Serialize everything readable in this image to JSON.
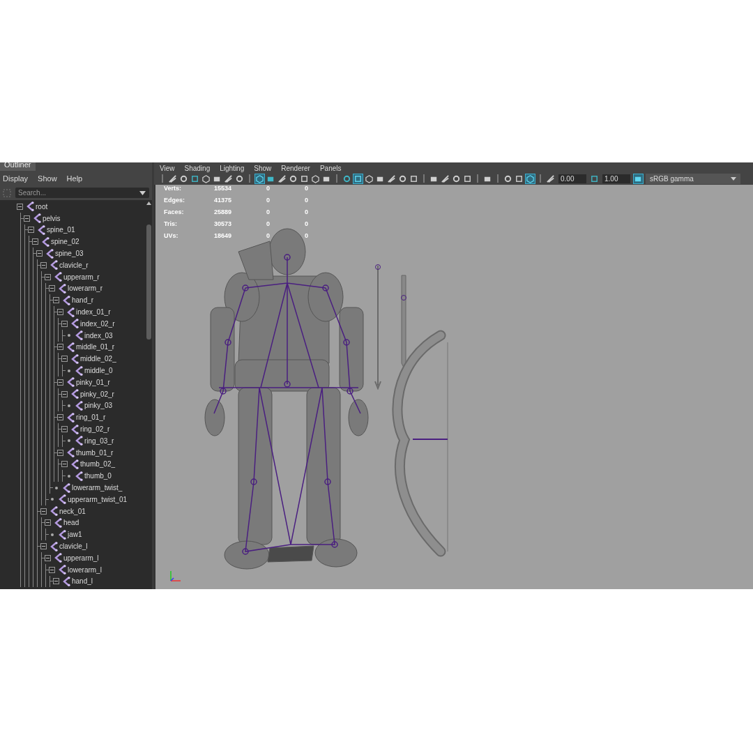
{
  "outliner": {
    "title": "Outliner",
    "menu": [
      "Display",
      "Show",
      "Help"
    ],
    "search": {
      "placeholder": "Search..."
    },
    "tree": [
      {
        "label": "root",
        "expanded": true,
        "children": [
          {
            "label": "pelvis",
            "expanded": true,
            "children": [
              {
                "label": "spine_01",
                "expanded": true,
                "children": [
                  {
                    "label": "spine_02",
                    "expanded": true,
                    "children": [
                      {
                        "label": "spine_03",
                        "expanded": true,
                        "children": [
                          {
                            "label": "clavicle_r",
                            "expanded": true,
                            "children": [
                              {
                                "label": "upperarm_r",
                                "expanded": true,
                                "children": [
                                  {
                                    "label": "lowerarm_r",
                                    "expanded": true,
                                    "children": [
                                      {
                                        "label": "hand_r",
                                        "expanded": true,
                                        "children": [
                                          {
                                            "label": "index_01_r",
                                            "expanded": true,
                                            "children": [
                                              {
                                                "label": "index_02_r",
                                                "expanded": true,
                                                "children": [
                                                  {
                                                    "label": "index_03"
                                                  }
                                                ]
                                              }
                                            ]
                                          },
                                          {
                                            "label": "middle_01_r",
                                            "expanded": true,
                                            "children": [
                                              {
                                                "label": "middle_02_",
                                                "expanded": true,
                                                "children": [
                                                  {
                                                    "label": "middle_0"
                                                  }
                                                ]
                                              }
                                            ]
                                          },
                                          {
                                            "label": "pinky_01_r",
                                            "expanded": true,
                                            "children": [
                                              {
                                                "label": "pinky_02_r",
                                                "expanded": true,
                                                "children": [
                                                  {
                                                    "label": "pinky_03"
                                                  }
                                                ]
                                              }
                                            ]
                                          },
                                          {
                                            "label": "ring_01_r",
                                            "expanded": true,
                                            "children": [
                                              {
                                                "label": "ring_02_r",
                                                "expanded": true,
                                                "children": [
                                                  {
                                                    "label": "ring_03_r"
                                                  }
                                                ]
                                              }
                                            ]
                                          },
                                          {
                                            "label": "thumb_01_r",
                                            "expanded": true,
                                            "children": [
                                              {
                                                "label": "thumb_02_",
                                                "expanded": true,
                                                "children": [
                                                  {
                                                    "label": "thumb_0"
                                                  }
                                                ]
                                              }
                                            ]
                                          }
                                        ]
                                      },
                                      {
                                        "label": "lowerarm_twist_"
                                      }
                                    ]
                                  },
                                  {
                                    "label": "upperarm_twist_01"
                                  }
                                ]
                              }
                            ]
                          },
                          {
                            "label": "neck_01",
                            "expanded": true,
                            "children": [
                              {
                                "label": "head",
                                "expanded": true,
                                "children": [
                                  {
                                    "label": "jaw1"
                                  }
                                ]
                              }
                            ]
                          },
                          {
                            "label": "clavicle_l",
                            "expanded": true,
                            "children": [
                              {
                                "label": "upperarm_l",
                                "expanded": true,
                                "children": [
                                  {
                                    "label": "lowerarm_l",
                                    "expanded": true,
                                    "children": [
                                      {
                                        "label": "hand_l",
                                        "expanded": true
                                      }
                                    ]
                                  }
                                ]
                              }
                            ]
                          }
                        ]
                      }
                    ]
                  }
                ]
              }
            ]
          }
        ]
      }
    ]
  },
  "viewport": {
    "menu": [
      "View",
      "Shading",
      "Lighting",
      "Show",
      "Renderer",
      "Panels"
    ],
    "toolbar": [
      {
        "kind": "separator"
      },
      {
        "kind": "icon",
        "selected": false
      },
      {
        "kind": "icon",
        "selected": false
      },
      {
        "kind": "icon",
        "selected": false
      },
      {
        "kind": "icon",
        "selected": false
      },
      {
        "kind": "icon",
        "selected": false
      },
      {
        "kind": "icon",
        "selected": false
      },
      {
        "kind": "icon",
        "selected": false
      },
      {
        "kind": "separator"
      },
      {
        "kind": "icon",
        "selected": true
      },
      {
        "kind": "icon",
        "selected": false
      },
      {
        "kind": "icon",
        "selected": false
      },
      {
        "kind": "icon",
        "selected": false
      },
      {
        "kind": "icon",
        "selected": false
      },
      {
        "kind": "icon",
        "selected": false
      },
      {
        "kind": "icon",
        "selected": false
      },
      {
        "kind": "separator"
      },
      {
        "kind": "icon",
        "selected": false
      },
      {
        "kind": "icon",
        "selected": true
      },
      {
        "kind": "icon",
        "selected": false
      },
      {
        "kind": "icon",
        "selected": false
      },
      {
        "kind": "icon",
        "selected": false
      },
      {
        "kind": "icon",
        "selected": false
      },
      {
        "kind": "icon",
        "selected": false
      },
      {
        "kind": "separator"
      },
      {
        "kind": "icon",
        "selected": false
      },
      {
        "kind": "icon",
        "selected": false
      },
      {
        "kind": "icon",
        "selected": false
      },
      {
        "kind": "icon",
        "selected": false
      },
      {
        "kind": "separator"
      },
      {
        "kind": "icon",
        "selected": false
      },
      {
        "kind": "separator"
      },
      {
        "kind": "icon",
        "selected": false
      },
      {
        "kind": "icon",
        "selected": false
      },
      {
        "kind": "icon",
        "selected": true
      },
      {
        "kind": "separator"
      },
      {
        "kind": "icon",
        "selected": false
      },
      {
        "kind": "field",
        "value": "0.00"
      },
      {
        "kind": "icon",
        "selected": false
      },
      {
        "kind": "field",
        "value": "1.00"
      },
      {
        "kind": "icon",
        "selected": true
      },
      {
        "kind": "dropdown",
        "value": "sRGB gamma"
      }
    ],
    "stats": [
      {
        "label": "Verts:",
        "values": [
          "15534",
          "0",
          "0"
        ]
      },
      {
        "label": "Edges:",
        "values": [
          "41375",
          "0",
          "0"
        ]
      },
      {
        "label": "Faces:",
        "values": [
          "25889",
          "0",
          "0"
        ]
      },
      {
        "label": "Tris:",
        "values": [
          "30573",
          "0",
          "0"
        ]
      },
      {
        "label": "UVs:",
        "values": [
          "18649",
          "0",
          "0"
        ]
      }
    ]
  }
}
